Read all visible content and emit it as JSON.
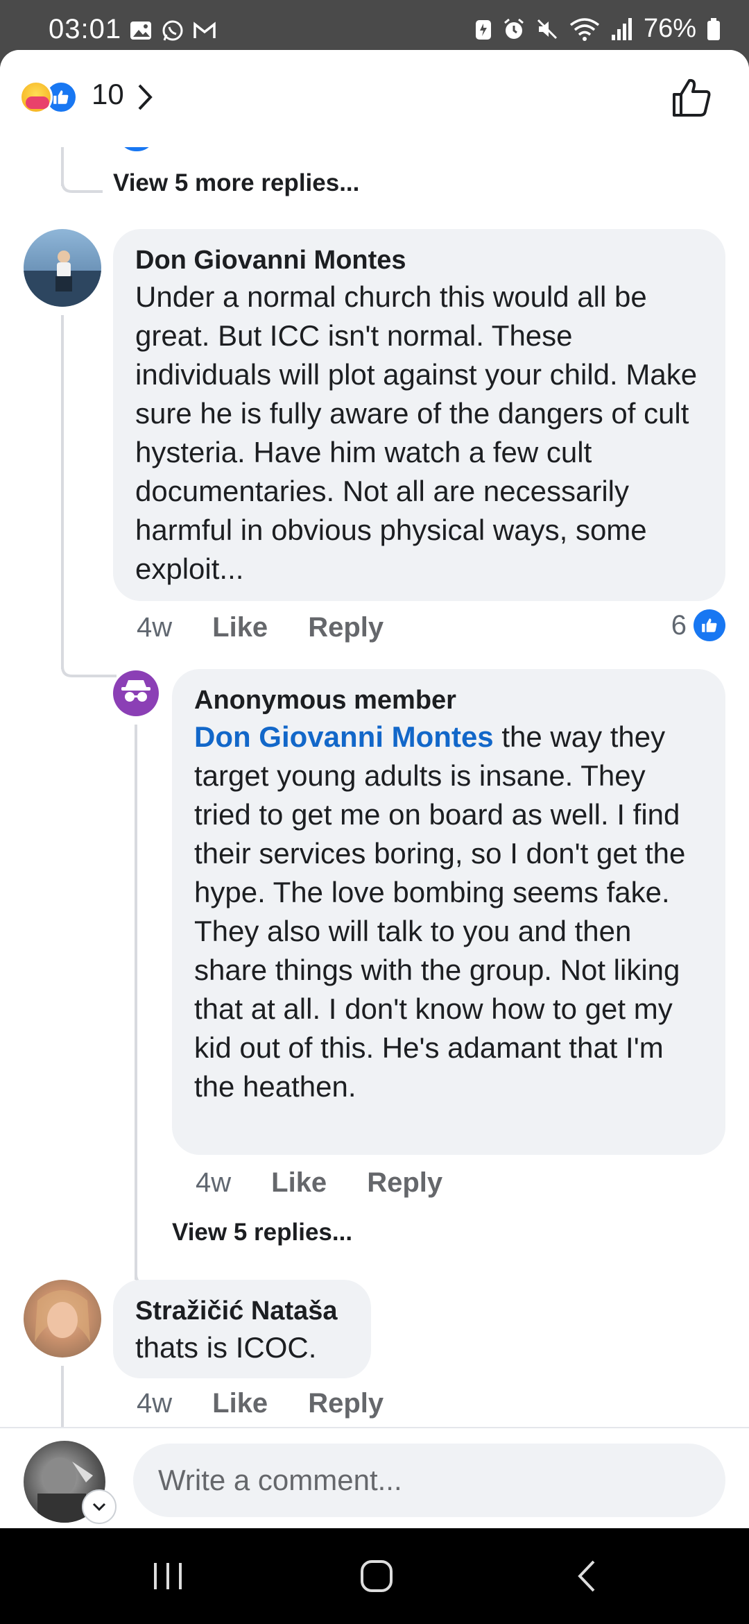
{
  "status_bar": {
    "time": "03:01",
    "battery": "76%",
    "left_icons": [
      "gallery-icon",
      "whatsapp-icon",
      "gmail-icon"
    ],
    "right_icons": [
      "battery-saver-icon",
      "alarm-icon",
      "mute-icon",
      "wifi-icon",
      "signal-icon",
      "battery-icon"
    ]
  },
  "reactions": {
    "count": "10",
    "types": [
      "care",
      "like"
    ]
  },
  "thread": {
    "view_more_top": "View 5 more replies...",
    "comments": [
      {
        "author": "Don Giovanni Montes",
        "text": "Under a normal church this would all be great. But ICC isn't normal. These individuals will plot against your child. Make sure he is fully aware of the dangers of cult hysteria. Have him watch a few cult documentaries. Not all are necessarily harmful in obvious physical ways, some exploit...",
        "time": "4w",
        "like_label": "Like",
        "reply_label": "Reply",
        "likes": "6"
      },
      {
        "author": "Anonymous member",
        "mention": "Don Giovanni Montes",
        "text": " the way they target young adults is insane. They tried to get me on board as well. I find their services boring, so I don't get the hype. The love bombing seems fake.\nThey also will talk to you and then share things with the group. Not liking that at all. I don't know how to get my kid out of this. He's adamant that I'm the heathen.",
        "time": "4w",
        "like_label": "Like",
        "reply_label": "Reply"
      },
      {
        "author": "Stražičić Nataša",
        "text": "thats is ICOC.",
        "time": "4w",
        "like_label": "Like",
        "reply_label": "Reply"
      }
    ],
    "view_replies": "View 5 replies..."
  },
  "composer": {
    "placeholder": "Write a comment..."
  },
  "colors": {
    "accent": "#1877f2",
    "mention": "#1267c9",
    "bubble": "#f0f2f5"
  }
}
